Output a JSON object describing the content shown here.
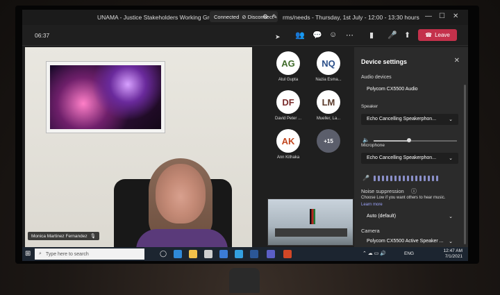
{
  "window": {
    "title": "UNAMA - Justice Stakeholders Working Group Mee",
    "title_tail": "rms/needs - Thursday, 1st July - 12:00 - 13:30 hours",
    "connected_label": "Connected",
    "disconnect_label": "Disconnect"
  },
  "toolbar": {
    "timer": "06:37",
    "leave_label": "Leave"
  },
  "stage": {
    "speaker_name": "Monica Martinez Fernandez"
  },
  "participants": [
    {
      "initials": "AG",
      "name": "Atul Gupta",
      "color": "#ffffff",
      "fg": "#3f6b2a"
    },
    {
      "initials": "NQ",
      "name": "Nazia Esma...",
      "color": "#ffffff",
      "fg": "#2b4f8a"
    },
    {
      "initials": "DF",
      "name": "David Peter ...",
      "color": "#ffffff",
      "fg": "#7a2c2c"
    },
    {
      "initials": "LM",
      "name": "Mueller, La...",
      "color": "#ffffff",
      "fg": "#5a3a2a"
    },
    {
      "initials": "AK",
      "name": "Ann Kithaka",
      "color": "#ffffff",
      "fg": "#c2461e"
    }
  ],
  "more_participants": "+15",
  "device_settings": {
    "title": "Device settings",
    "audio_devices_label": "Audio devices",
    "audio_devices_value": "Polycom CX5500 Audio",
    "speaker_label": "Speaker",
    "speaker_value": "Echo Cancelling Speakerphon...",
    "microphone_label": "Microphone",
    "microphone_value": "Echo Cancelling Speakerphon...",
    "noise_label": "Noise suppression",
    "noise_desc": "Choose Low if you want others to hear music.",
    "learn_more": "Learn more",
    "noise_value": "Auto (default)",
    "camera_label": "Camera",
    "camera_value": "Polycom CX5500 Active Speaker ..."
  },
  "taskbar": {
    "search_placeholder": "Type here to search",
    "lang": "ENG",
    "time": "12:47 AM",
    "date": "7/1/2021"
  }
}
